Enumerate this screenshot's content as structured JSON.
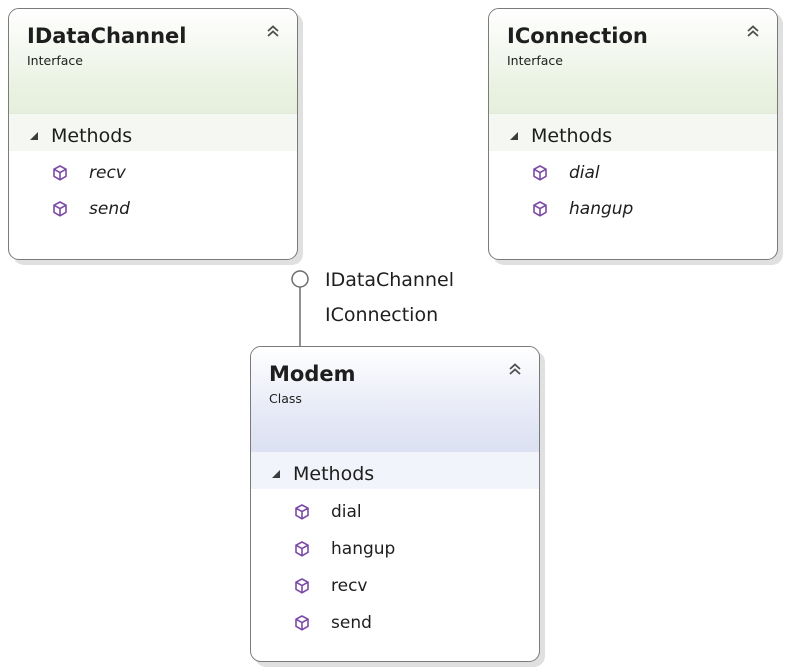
{
  "shapes": {
    "idatachannel": {
      "title": "IDataChannel",
      "stereotype": "Interface",
      "compartment": "Methods",
      "members": [
        "recv",
        "send"
      ]
    },
    "iconnection": {
      "title": "IConnection",
      "stereotype": "Interface",
      "compartment": "Methods",
      "members": [
        "dial",
        "hangup"
      ]
    },
    "modem": {
      "title": "Modem",
      "stereotype": "Class",
      "compartment": "Methods",
      "members": [
        "dial",
        "hangup",
        "recv",
        "send"
      ]
    }
  },
  "lollipop": {
    "labels": [
      "IDataChannel",
      "IConnection"
    ]
  },
  "colors": {
    "interface_header": "#e6efdd",
    "class_header": "#dce2f3",
    "method_icon": "#7b4aa6",
    "border": "#7a7a7a"
  },
  "icons": {
    "collapse": "double-chevron-up-icon",
    "expander": "triangle-expander-icon",
    "method": "method-cube-icon"
  }
}
